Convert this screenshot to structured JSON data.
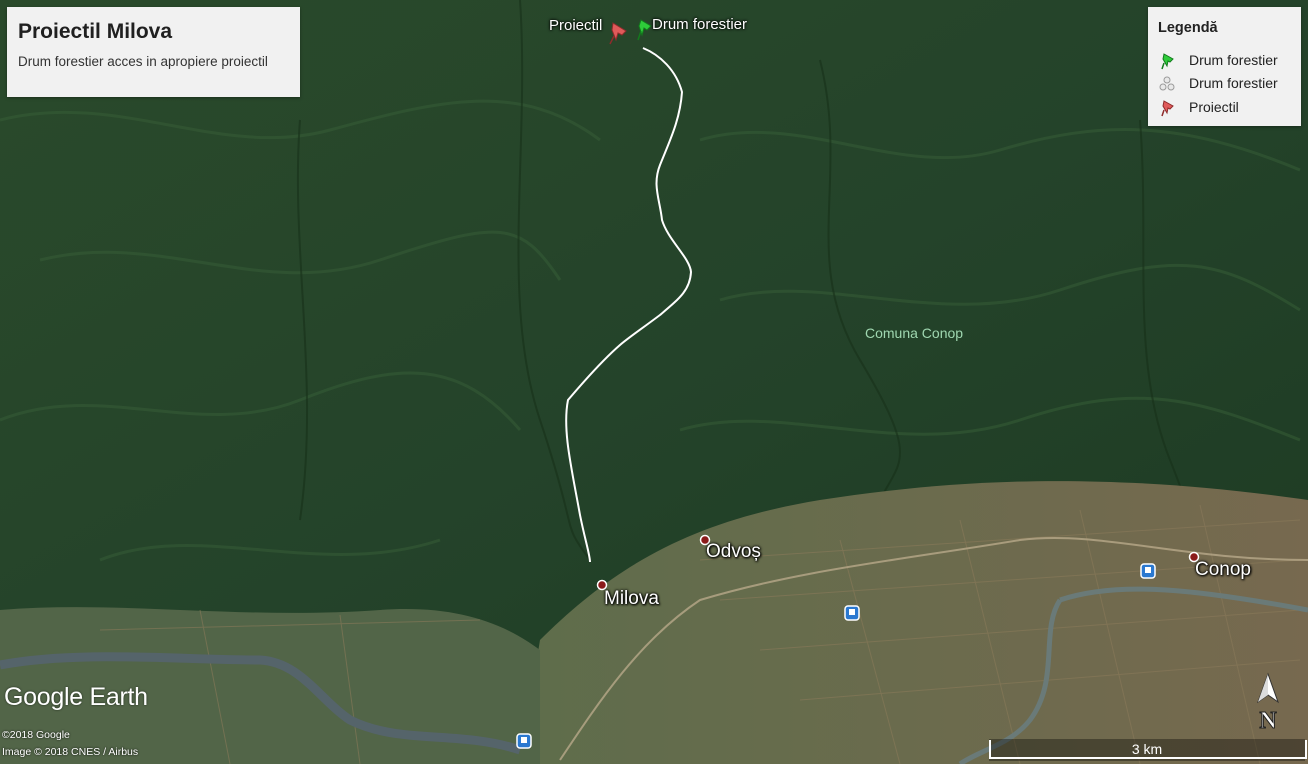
{
  "title_box": {
    "title": "Proiectil Milova",
    "subtitle": "Drum forestier acces in apropiere proiectil"
  },
  "legend": {
    "title": "Legendă",
    "items": [
      {
        "label": "Drum forestier",
        "icon": "green-pushpin-icon",
        "color": "#2ecc3a"
      },
      {
        "label": "Drum forestier",
        "icon": "path-nodes-icon",
        "color": "#cfcfcf"
      },
      {
        "label": "Proiectil",
        "icon": "red-pushpin-icon",
        "color": "#e05a5a"
      }
    ]
  },
  "pins": {
    "proiectil_label": "Proiectil",
    "drum_label": "Drum forestier"
  },
  "places": {
    "milova": "Milova",
    "odvos": "Odvoș",
    "conop": "Conop",
    "comuna": "Comuna Conop"
  },
  "branding": {
    "logo": "Google Earth",
    "copyright_1": "©2018 Google",
    "copyright_2": "Image © 2018 CNES / Airbus"
  },
  "scale": {
    "label": "3 km"
  },
  "compass": {
    "label": "N"
  },
  "colors": {
    "forest_dark": "#1f3b22",
    "forest_mid": "#2e5230",
    "farmland": "#6d7a55",
    "river": "#5f6e74",
    "route": "#ffffff",
    "commune_label": "#9fd7b0"
  }
}
